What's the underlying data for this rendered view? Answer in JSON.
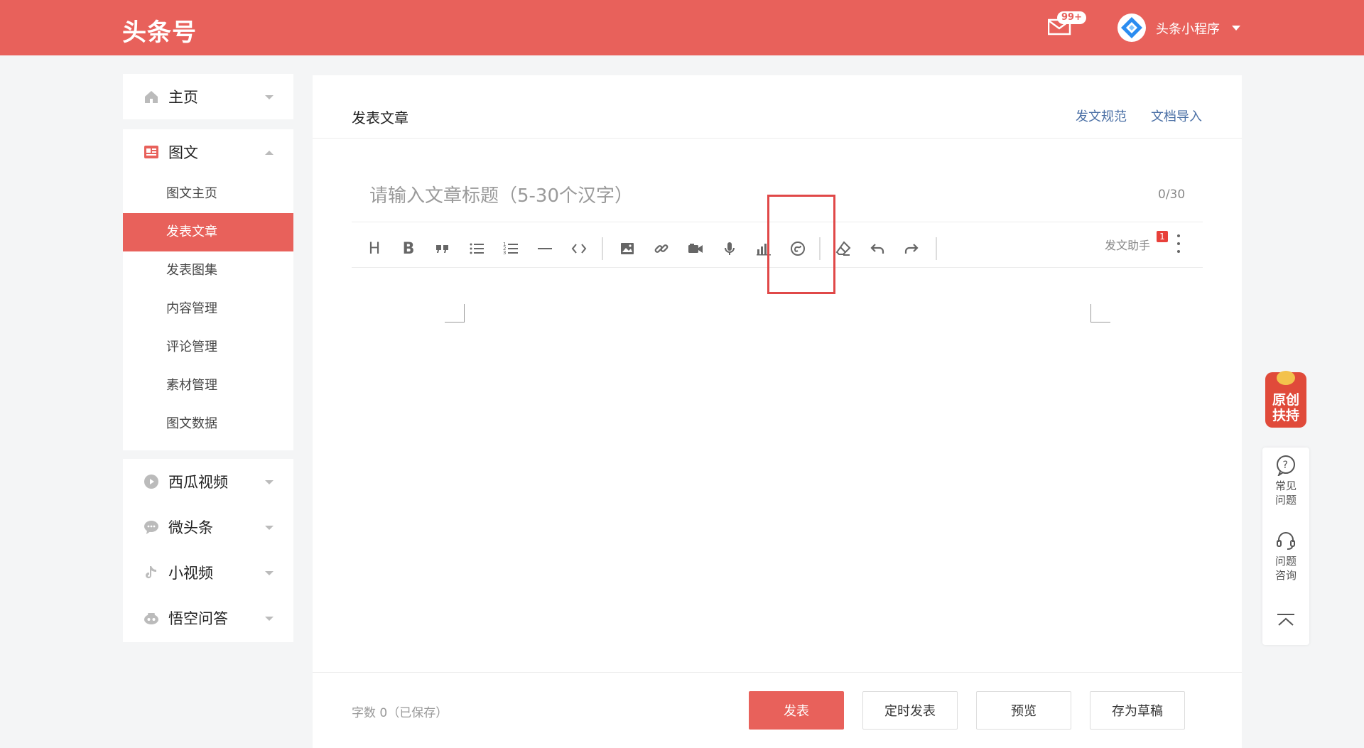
{
  "header": {
    "logo": "头条号",
    "mail_badge": "99+",
    "user_name": "头条小程序"
  },
  "sidebar": {
    "home": "主页",
    "article_group": {
      "title": "图文",
      "items": [
        "图文主页",
        "发表文章",
        "发表图集",
        "内容管理",
        "评论管理",
        "素材管理",
        "图文数据"
      ],
      "active": "发表文章"
    },
    "xigua": "西瓜视频",
    "weitoutiao": "微头条",
    "xiaoshipin": "小视频",
    "wukong": "悟空问答"
  },
  "main": {
    "title": "发表文章",
    "links": [
      "发文规范",
      "文档导入"
    ],
    "title_placeholder": "请输入文章标题（5-30个汉字）",
    "title_counter": "0/30",
    "toolbar": {
      "heading": "H",
      "bold": "B",
      "helper_label": "发文助手",
      "helper_badge": "1"
    },
    "word_count": "字数 0（已保存）",
    "buttons": {
      "publish": "发表",
      "schedule": "定时发表",
      "preview": "预览",
      "draft": "存为草稿"
    }
  },
  "float": {
    "promo_line1": "原创",
    "promo_line2": "扶持",
    "faq_line1": "常见",
    "faq_line2": "问题",
    "consult_line1": "问题",
    "consult_line2": "咨询"
  },
  "colors": {
    "brand": "#e8615b",
    "link": "#4a6fa5",
    "highlight": "#e04848"
  }
}
